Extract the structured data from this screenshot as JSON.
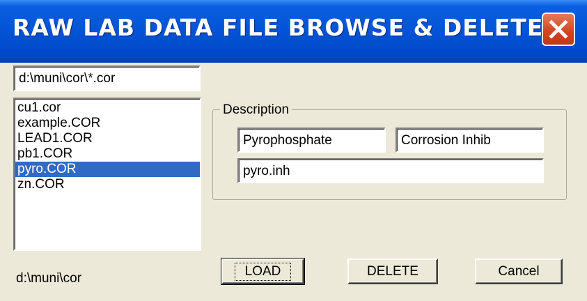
{
  "window": {
    "title": "RAW LAB DATA FILE BROWSE & DELETE",
    "close_icon": "close-x-icon"
  },
  "file_mask": {
    "value": "d:\\muni\\cor\\*.cor"
  },
  "file_list": {
    "items": [
      "cu1.cor",
      "example.COR",
      "LEAD1.COR",
      "pb1.COR",
      "pyro.COR",
      "zn.COR"
    ],
    "selected_index": 4
  },
  "current_dir": "d:\\muni\\cor",
  "description": {
    "label": "Description",
    "field1": "Pyrophosphate",
    "field2": "Corrosion Inhib",
    "field3": "pyro.inh"
  },
  "buttons": {
    "load": "LOAD",
    "delete": "DELETE",
    "cancel": "Cancel"
  },
  "colors": {
    "titlebar": "#0453d6",
    "selection": "#316ac5",
    "dialog_bg": "#ece9d8",
    "close_button": "#d0441e"
  }
}
